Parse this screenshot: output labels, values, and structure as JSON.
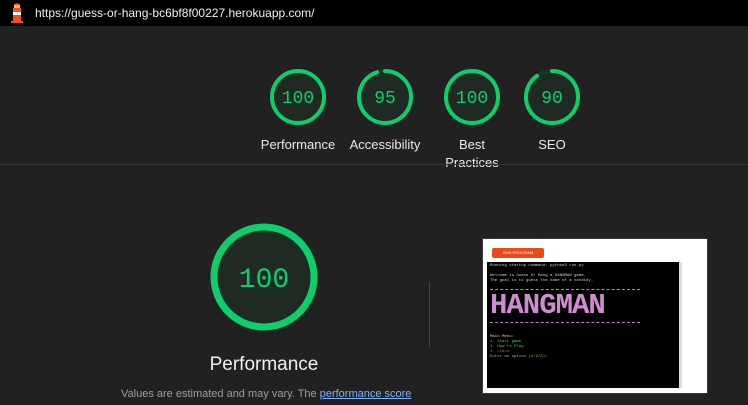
{
  "browser": {
    "url": "https://guess-or-hang-bc6bf8f00227.herokuapp.com/"
  },
  "colors": {
    "pass": "#0cce6b",
    "pass_track": "#0b3d22",
    "link": "#7cb4ff"
  },
  "summary": {
    "gauges": [
      {
        "score": 100,
        "label_lines": [
          "Performance"
        ]
      },
      {
        "score": 95,
        "label_lines": [
          "Accessibility"
        ]
      },
      {
        "score": 100,
        "label_lines": [
          "Best",
          "Practices"
        ]
      },
      {
        "score": 90,
        "label_lines": [
          "SEO"
        ]
      }
    ]
  },
  "performance": {
    "score": 100,
    "title": "Performance",
    "note_text": "Values are estimated and may vary. The ",
    "note_link": "performance score"
  },
  "screenshot": {
    "run_button": "RUN PROGRAM",
    "terminal_lines": [
      "Running startup command: python3 run.py",
      "",
      "Welcome to Guess Or Hang a HANGMAN game.",
      "The goal is to guess the name of a candidy."
    ],
    "banner": "HANGMAN",
    "menu_title": "Main Menu:",
    "menu_items": [
      "1. Start game",
      "2. How to Play",
      "3. Leave"
    ],
    "prompt": "Enter an option (1/2/3):"
  }
}
